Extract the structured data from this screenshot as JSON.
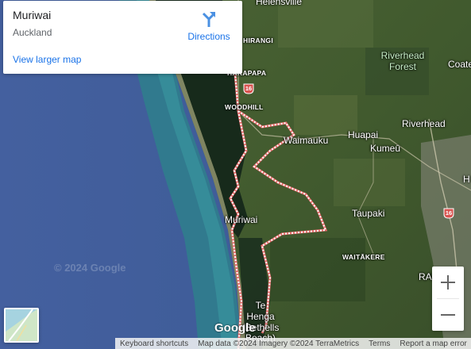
{
  "info_card": {
    "title": "Muriwai",
    "subtitle": "Auckland",
    "directions_label": "Directions",
    "view_larger_label": "View larger map"
  },
  "map": {
    "places": {
      "helensville": "Helensville",
      "parakai_area": "HIRANGI",
      "waimauku_north": "WAIMAUKU",
      "whakapapa": "HAKAPAPA",
      "woodhill": "WOODHILL",
      "riverhead_forest": "Riverhead Forest",
      "coatesville": "Coate",
      "waimauku": "Waimauku",
      "huapai": "Huapai",
      "kumeu": "Kumeū",
      "riverhead": "Riverhead",
      "taupaki": "Taupaki",
      "muriwai": "Muriwai",
      "waitakere": "WAITĀKERE",
      "te_henga": "Te Henga (Bethells Beach)",
      "ranui": "RAN",
      "hobsonville": "H"
    },
    "highway_number": "16",
    "watermark": "© 2024 Google",
    "logo": "Google"
  },
  "controls": {
    "zoom_in": "+",
    "zoom_out": "−"
  },
  "footer": {
    "keyboard": "Keyboard shortcuts",
    "attribution": "Map data ©2024 Imagery ©2024 TerraMetrics",
    "terms": "Terms",
    "report": "Report a map error"
  },
  "colors": {
    "ocean": "#3a5a9a",
    "surf": "#2e8a96",
    "land": "#3f5a2c",
    "forest": "#16261a",
    "boundary": "#e9716f",
    "link": "#1a73e8"
  }
}
